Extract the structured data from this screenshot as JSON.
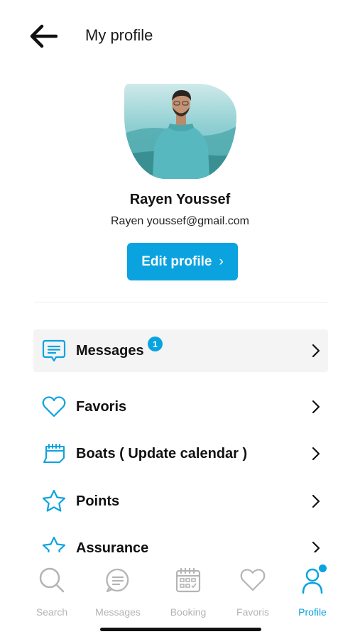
{
  "header": {
    "title": "My profile",
    "back_icon": "arrow-left-icon"
  },
  "profile": {
    "name": "Rayen Youssef",
    "email": "Rayen youssef@gmail.com",
    "edit_label": "Edit profile",
    "edit_chevron": "›"
  },
  "menu": {
    "items": [
      {
        "label": "Messages",
        "icon": "message-icon",
        "badge": "1",
        "active": true
      },
      {
        "label": "Favoris",
        "icon": "heart-icon"
      },
      {
        "label": "Boats ( Update calendar )",
        "icon": "calendar-icon"
      },
      {
        "label": "Points",
        "icon": "star-icon"
      },
      {
        "label": "Assurance",
        "icon": "settings-icon"
      }
    ]
  },
  "tabbar": {
    "items": [
      {
        "label": "Search",
        "icon": "search-icon"
      },
      {
        "label": "Messages",
        "icon": "chat-icon"
      },
      {
        "label": "Booking",
        "icon": "calendar-icon"
      },
      {
        "label": "Favoris",
        "icon": "heart-icon"
      },
      {
        "label": "Profile",
        "icon": "user-icon",
        "active": true
      }
    ]
  },
  "colors": {
    "accent": "#0aa3e0",
    "inactive": "#b4b4b4",
    "active_row_bg": "#f4f4f4"
  }
}
